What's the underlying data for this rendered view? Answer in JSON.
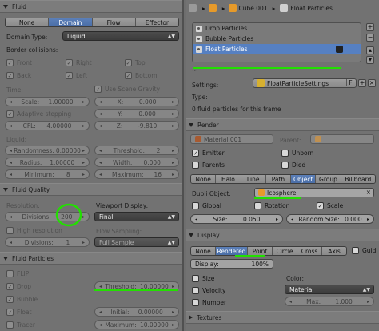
{
  "fluid": {
    "header": "Fluid",
    "tabs": [
      "None",
      "Domain",
      "Flow",
      "Effector"
    ],
    "active_tab": 1,
    "domain_type_label": "Domain Type:",
    "domain_type_value": "Liquid",
    "border_label": "Border collisions:",
    "border": {
      "front": "Front",
      "right": "Right",
      "top": "Top",
      "back": "Back",
      "left": "Left",
      "bottom": "Bottom"
    },
    "time_label": "Time:",
    "use_gravity": "Use Scene Gravity",
    "scale": "Scale:",
    "scale_val": "1.00000",
    "gx": "X:",
    "gx_val": "0.000",
    "adaptive": "Adaptive stepping",
    "gy": "Y:",
    "gy_val": "0.000",
    "cfl": "CFL:",
    "cfl_val": "4.00000",
    "gz": "Z:",
    "gz_val": "-9.810",
    "liquid_label": "Liquid:",
    "randomness": "Randomness:",
    "randomness_val": "0.00000",
    "threshold": "Threshold:",
    "threshold_val": "2",
    "radius": "Radius:",
    "radius_val": "1.00000",
    "width": "Width:",
    "width_val": "0.000",
    "minimum": "Minimum:",
    "minimum_val": "8",
    "maximum": "Maximum:",
    "maximum_val": "16"
  },
  "quality": {
    "header": "Fluid Quality",
    "resolution_label": "Resolution:",
    "viewport_label": "Viewport Display:",
    "divisions": "Divisions:",
    "divisions_val": "200",
    "viewport_val": "Final",
    "high_res": "High resolution",
    "flow_sampling": "Flow Sampling:",
    "divisions2": "Divisions:",
    "divisions2_val": "1",
    "flow_val": "Full Sample"
  },
  "fparticles": {
    "header": "Fluid Particles",
    "flip": "FLIP",
    "drop": "Drop",
    "threshold": "Threshold:",
    "threshold_val": "10.00000",
    "bubble": "Bubble",
    "float": "Float",
    "initial": "Initial:",
    "initial_val": "0.00000",
    "tracer": "Tracer",
    "maximum": "Maximum:",
    "maximum_val": "10.00000"
  },
  "header": {
    "object": "Cube.001",
    "psys": "Float Particles"
  },
  "psystems": [
    {
      "name": "Drop Particles"
    },
    {
      "name": "Bubble Particles"
    },
    {
      "name": "Float Particles"
    }
  ],
  "settings": {
    "label": "Settings:",
    "value": "FloatParticleSettings",
    "f": "F",
    "type_label": "Type:",
    "info": "0 fluid particles for this frame"
  },
  "render": {
    "header": "Render",
    "material": "Material.001",
    "parent": "Parent:",
    "emitter": "Emitter",
    "unborn": "Unborn",
    "parents": "Parents",
    "died": "Died",
    "types": [
      "None",
      "Halo",
      "Line",
      "Path",
      "Object",
      "Group",
      "Billboard"
    ],
    "active_type": 4,
    "dupli_label": "Dupli Object:",
    "dupli_value": "Icosphere",
    "global": "Global",
    "rotation": "Rotation",
    "scale": "Scale",
    "size": "Size:",
    "size_val": "0.050",
    "random_size": "Random Size:",
    "random_size_val": "0.000"
  },
  "display": {
    "header": "Display",
    "modes": [
      "None",
      "Rendered",
      "Point",
      "Circle",
      "Cross",
      "Axis"
    ],
    "active_mode": 1,
    "guide": "Guid",
    "display_label": "Display:",
    "display_val": "100%",
    "size": "Size",
    "color_label": "Color:",
    "velocity": "Velocity",
    "color_val": "Material",
    "number": "Number",
    "max": "Max:",
    "max_val": "1.000"
  },
  "textures": {
    "header": "Textures"
  },
  "colors": {
    "accent": "#5680c2",
    "highlight": "#22e000"
  }
}
